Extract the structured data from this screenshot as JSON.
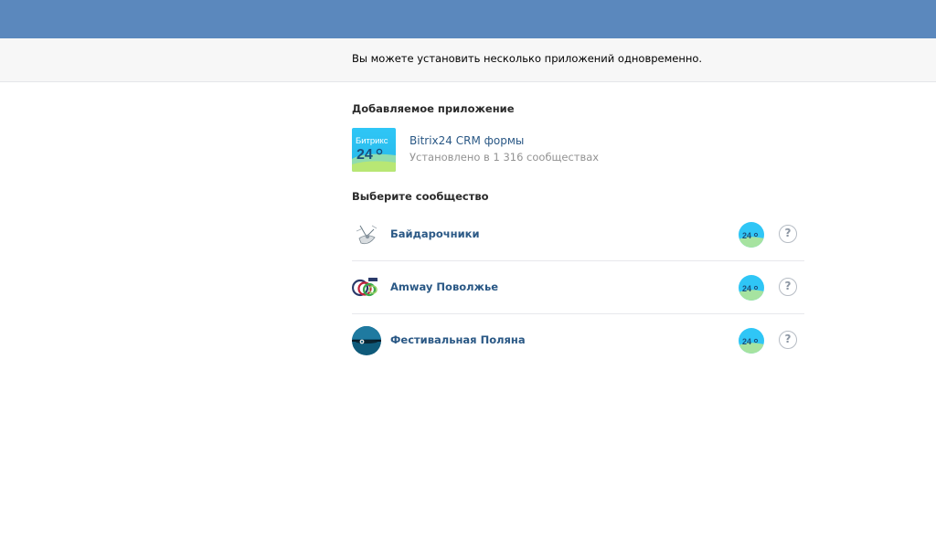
{
  "notice": {
    "text": "Вы можете установить несколько приложений одновременно."
  },
  "app_section": {
    "title": "Добавляемое приложение",
    "app": {
      "icon_text": "Битрикс",
      "icon_number": "24",
      "name": "Bitrix24 CRM формы",
      "subtitle": "Установлено в 1 316 сообществах"
    }
  },
  "community_section": {
    "title": "Выберите сообщество",
    "items": [
      {
        "name": "Байдарочники",
        "avatar": "kayak-avatar-icon",
        "help": "?"
      },
      {
        "name": "Amway Поволжье",
        "avatar": "amway-avatar-icon",
        "help": "?"
      },
      {
        "name": "Фестивальная Поляна",
        "avatar": "festival-avatar-icon",
        "help": "?"
      }
    ]
  },
  "colors": {
    "topbar": "#5b88bd",
    "link": "#2a5885",
    "muted": "#939393"
  }
}
